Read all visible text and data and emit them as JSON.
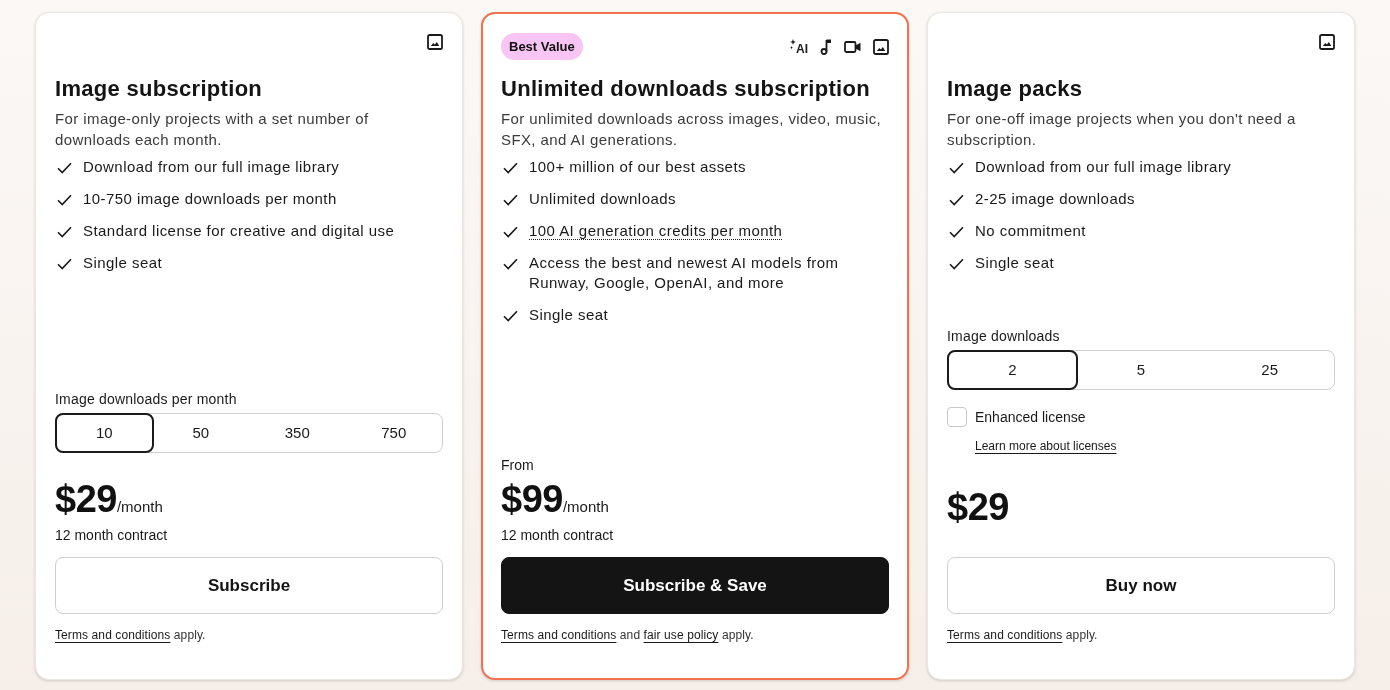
{
  "plans": [
    {
      "highlighted": false,
      "media": [
        {
          "kind": "image"
        }
      ],
      "title": "Image subscription",
      "description": "For image-only projects with a set number of downloads each month.",
      "features": [
        {
          "text": "Download from our full image library",
          "underlined": false
        },
        {
          "text": "10-750 image downloads per month",
          "underlined": false
        },
        {
          "text": "Standard license for creative and digital use",
          "underlined": false
        },
        {
          "text": "Single seat",
          "underlined": false
        }
      ],
      "options": {
        "label": "Image downloads per month",
        "items": [
          {
            "label": "10",
            "selected": true
          },
          {
            "label": "50",
            "selected": false
          },
          {
            "label": "350",
            "selected": false
          },
          {
            "label": "750",
            "selected": false
          }
        ]
      },
      "price": "$29",
      "price_unit": "/month",
      "contract": "12 month contract",
      "button": {
        "label": "Subscribe",
        "kind": "outline"
      },
      "footer": [
        {
          "kind": "link",
          "text": "Terms and conditions"
        },
        {
          "kind": "text",
          "text": "apply."
        }
      ]
    },
    {
      "highlighted": true,
      "badge": "Best Value",
      "media": [
        {
          "kind": "ai",
          "text": "AI"
        },
        {
          "kind": "music"
        },
        {
          "kind": "video"
        },
        {
          "kind": "image"
        }
      ],
      "title": "Unlimited downloads subscription",
      "description": "For unlimited downloads across images, video, music, SFX, and AI generations.",
      "features": [
        {
          "text": "100+ million of our best assets",
          "underlined": false
        },
        {
          "text": "Unlimited downloads",
          "underlined": false
        },
        {
          "text": "100 AI generation credits per month",
          "underlined": true
        },
        {
          "text": "Access the best and newest AI models from Runway, Google, OpenAI, and more",
          "underlined": false
        },
        {
          "text": "Single seat",
          "underlined": false
        }
      ],
      "price_note": "From",
      "price": "$99",
      "price_unit": "/month",
      "contract": "12 month contract",
      "button": {
        "label": "Subscribe & Save",
        "kind": "primary"
      },
      "footer": [
        {
          "kind": "link",
          "text": "Terms and conditions"
        },
        {
          "kind": "text",
          "text": "and"
        },
        {
          "kind": "link",
          "text": "fair use policy"
        },
        {
          "kind": "text",
          "text": "apply."
        }
      ]
    },
    {
      "highlighted": false,
      "media": [
        {
          "kind": "image"
        }
      ],
      "title": "Image packs",
      "description": "For one-off image projects when you don't need a subscription.",
      "features": [
        {
          "text": "Download from our full image library",
          "underlined": false
        },
        {
          "text": "2-25 image downloads",
          "underlined": false
        },
        {
          "text": "No commitment",
          "underlined": false
        },
        {
          "text": "Single seat",
          "underlined": false
        }
      ],
      "options": {
        "label": "Image downloads",
        "items": [
          {
            "label": "2",
            "selected": true
          },
          {
            "label": "5",
            "selected": false
          },
          {
            "label": "25",
            "selected": false
          }
        ]
      },
      "addon": {
        "label": "Enhanced license",
        "checked": false,
        "link": "Learn more about licenses"
      },
      "price": "$29",
      "button": {
        "label": "Buy now",
        "kind": "outline"
      },
      "footer": [
        {
          "kind": "link",
          "text": "Terms and conditions"
        },
        {
          "kind": "text",
          "text": "apply."
        }
      ]
    }
  ]
}
